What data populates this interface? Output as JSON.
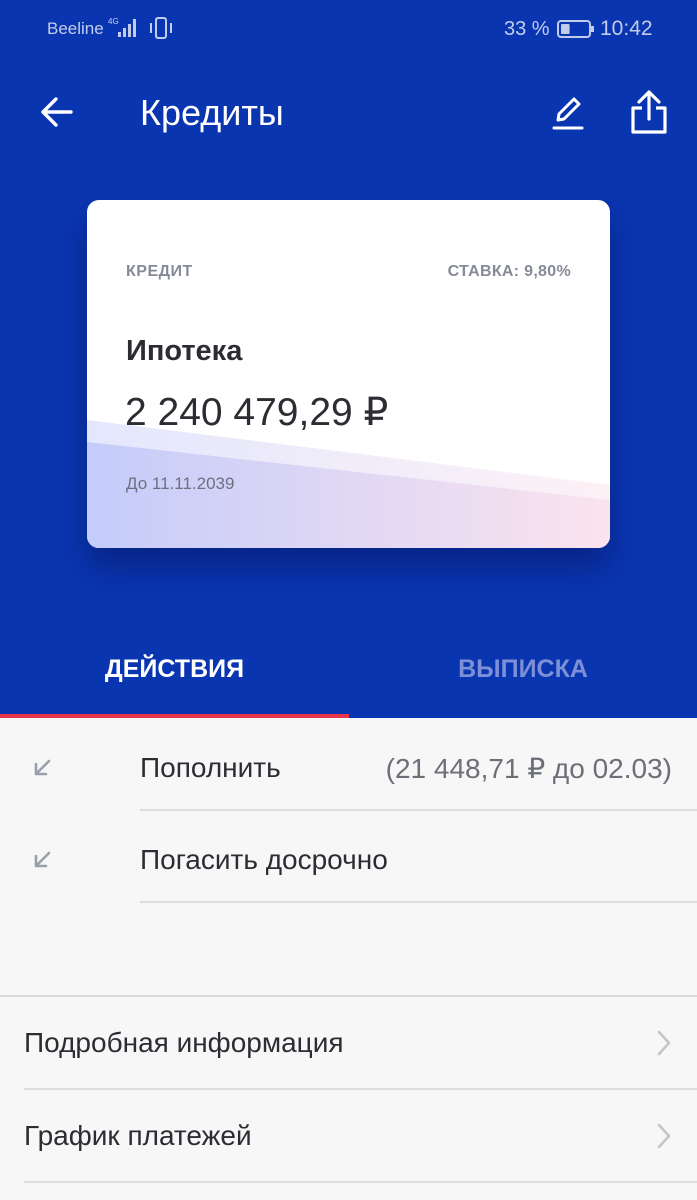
{
  "status_bar": {
    "carrier": "Beeline",
    "network": "4G",
    "battery_percent": "33 %",
    "battery_level": 0.33,
    "time": "10:42"
  },
  "app_bar": {
    "title": "Кредиты",
    "back_icon": "arrow-left-icon",
    "edit_icon": "pencil-icon",
    "share_icon": "share-icon"
  },
  "loan_card": {
    "type_label": "КРЕДИТ",
    "rate_label": "СТАВКА: 9,80%",
    "name": "Ипотека",
    "amount": "2 240 479,29 ₽",
    "due": "До 11.11.2039"
  },
  "tabs": [
    {
      "label": "ДЕЙСТВИЯ",
      "active": true
    },
    {
      "label": "ВЫПИСКА",
      "active": false
    }
  ],
  "actions": [
    {
      "label": "Пополнить",
      "note": "(21 448,71 ₽ до 02.03)",
      "icon": "arrow-down-left-icon"
    },
    {
      "label": "Погасить досрочно",
      "note": "",
      "icon": "arrow-down-left-icon"
    }
  ],
  "info_items": [
    {
      "label": "Подробная информация",
      "icon": "chevron-right-icon"
    },
    {
      "label": "График платежей",
      "icon": "chevron-right-icon"
    }
  ],
  "colors": {
    "header_bg": "#0a35b0",
    "tab_indicator": "#e8364d",
    "tab_inactive": "#7d8fd6"
  }
}
